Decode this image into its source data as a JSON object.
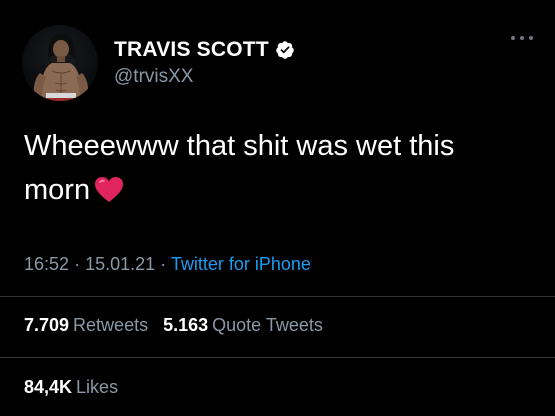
{
  "author": {
    "display_name": "TRAVIS SCOTT",
    "handle": "@trvisXX",
    "verified": true
  },
  "tweet": {
    "text_line1": "Wheeewww that shit was wet this",
    "text_line2": "morn",
    "emoji": "heart-emoji",
    "time": "16:52",
    "separator": "·",
    "date": "15.01.21",
    "source": "Twitter for iPhone"
  },
  "stats": {
    "retweets_count": "7.709",
    "retweets_label": "Retweets",
    "quote_tweets_count": "5.163",
    "quote_tweets_label": "Quote Tweets",
    "likes_count": "84,4K",
    "likes_label": "Likes"
  },
  "colors": {
    "background": "#000000",
    "primary_text": "#ffffff",
    "secondary_text": "#8b98a5",
    "link": "#1d9bf0",
    "divider": "#2f3336",
    "heart": "#e0245e"
  },
  "icons": {
    "verified": "verified-badge-icon",
    "more": "more-options-icon"
  }
}
